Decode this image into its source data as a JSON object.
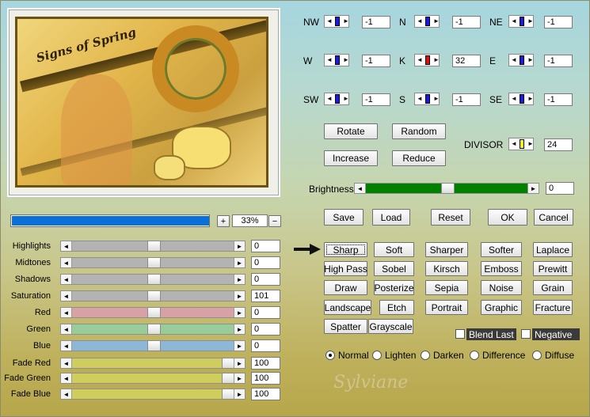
{
  "preview": {
    "title": "Signs of Spring"
  },
  "zoom": {
    "value": "33%",
    "fraction": 0.33,
    "plus": "+",
    "minus": "−"
  },
  "matrix": {
    "nw": {
      "label": "NW",
      "value": "-1"
    },
    "n": {
      "label": "N",
      "value": "-1"
    },
    "ne": {
      "label": "NE",
      "value": "-1"
    },
    "w": {
      "label": "W",
      "value": "-1"
    },
    "k": {
      "label": "K",
      "value": "32"
    },
    "e": {
      "label": "E",
      "value": "-1"
    },
    "sw": {
      "label": "SW",
      "value": "-1"
    },
    "s": {
      "label": "S",
      "value": "-1"
    },
    "se": {
      "label": "SE",
      "value": "-1"
    }
  },
  "buttons": {
    "rotate": "Rotate",
    "random": "Random",
    "increase": "Increase",
    "reduce": "Reduce",
    "save": "Save",
    "load": "Load",
    "reset": "Reset",
    "ok": "OK",
    "cancel": "Cancel"
  },
  "divisor": {
    "label": "DIVISOR",
    "value": "24"
  },
  "brightness": {
    "label": "Brightness",
    "value": "0",
    "level": 0.5
  },
  "sliders": [
    {
      "label": "Highlights",
      "value": "0",
      "level": 0.5
    },
    {
      "label": "Midtones",
      "value": "0",
      "level": 0.5
    },
    {
      "label": "Shadows",
      "value": "0",
      "level": 0.5
    },
    {
      "label": "Saturation",
      "value": "101",
      "level": 0.5
    },
    {
      "label": "Red",
      "value": "0",
      "level": 0.5
    },
    {
      "label": "Green",
      "value": "0",
      "level": 0.5
    },
    {
      "label": "Blue",
      "value": "0",
      "level": 0.5
    }
  ],
  "fade": [
    {
      "label": "Fade Red",
      "value": "100",
      "level": 1
    },
    {
      "label": "Fade Green",
      "value": "100",
      "level": 1
    },
    {
      "label": "Fade Blue",
      "value": "100",
      "level": 1
    }
  ],
  "presets": [
    "Sharp",
    "Soft",
    "Sharper",
    "Softer",
    "Laplace",
    "High Pass",
    "Sobel",
    "Kirsch",
    "Emboss",
    "Prewitt",
    "Draw",
    "Posterize",
    "Sepia",
    "Noise",
    "Grain",
    "Landscape",
    "Etch",
    "Portrait",
    "Graphic",
    "Fracture",
    "Spatter",
    "Grayscale"
  ],
  "options": {
    "blend_last": "Blend Last",
    "negative": "Negative"
  },
  "modes": [
    "Normal",
    "Lighten",
    "Darken",
    "Difference",
    "Diffuse"
  ],
  "watermark": "Sylviane",
  "colors": {
    "slider_gray": "#b3b3b3",
    "slider_red": "#d9a1a6",
    "slider_green": "#98cc9b",
    "slider_blue": "#8db7d8",
    "slider_fade": "#cfcd5d",
    "brightness_track": "#008000",
    "k_knob": "#e01010",
    "divisor_knob": "#f5f500",
    "matrix_knob": "#1a1ad8",
    "zoom_fill": "#0a6fd8"
  }
}
